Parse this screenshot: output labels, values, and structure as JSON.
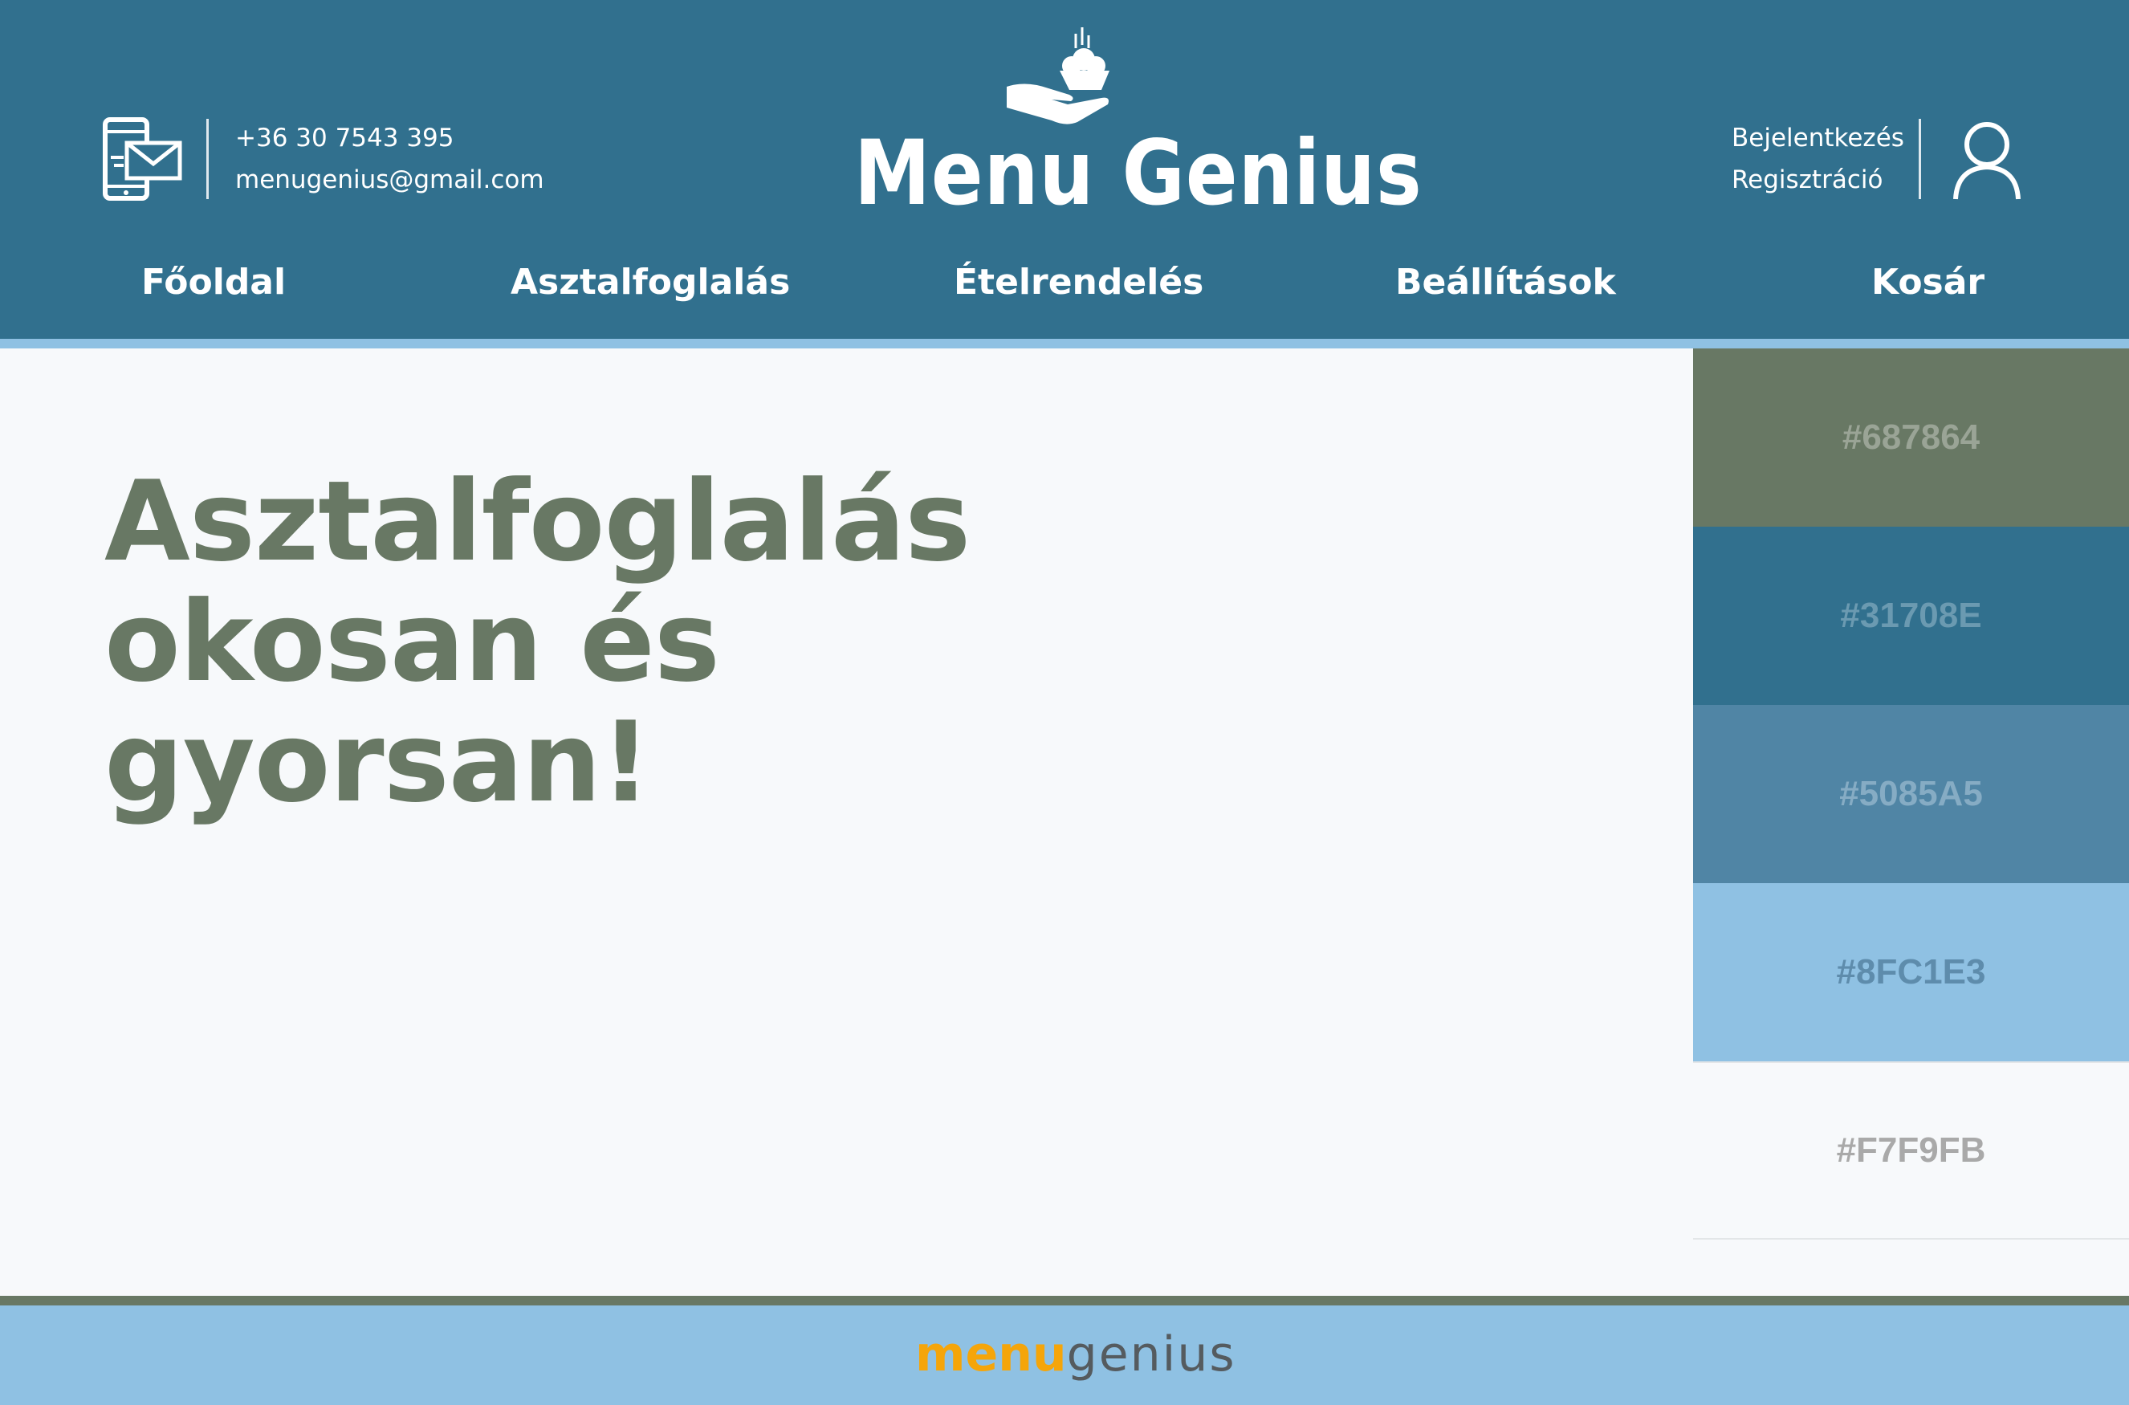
{
  "header": {
    "contact": {
      "phone": "+36 30 7543 395",
      "email": "menugenius@gmail.com",
      "icon": "phone-mail-icon"
    },
    "logo": {
      "text": "Menu Genius",
      "icon": "serving-hand-icon"
    },
    "auth": {
      "login": "Bejelentkezés",
      "register": "Regisztráció",
      "icon": "user-icon"
    }
  },
  "nav": {
    "items": [
      {
        "label": "Főoldal"
      },
      {
        "label": "Asztalfoglalás"
      },
      {
        "label": "Ételrendelés"
      },
      {
        "label": "Beállítások"
      },
      {
        "label": "Kosár"
      }
    ]
  },
  "hero": {
    "title_line1": "Asztalfoglalás",
    "title_line2": "okosan és",
    "title_line3": "gyorsan!"
  },
  "palette": [
    {
      "hex": "#687864"
    },
    {
      "hex": "#31708E"
    },
    {
      "hex": "#5085A5"
    },
    {
      "hex": "#8FC1E3"
    },
    {
      "hex": "#F7F9FB"
    }
  ],
  "footer": {
    "logo_part1": "menu",
    "logo_part2": "genius"
  },
  "colors": {
    "header_bg": "#31708E",
    "accent_light": "#8FC1E3",
    "hero_text": "#687864",
    "page_bg": "#F7F9FB",
    "footer_logo_orange": "#f5a50a"
  }
}
